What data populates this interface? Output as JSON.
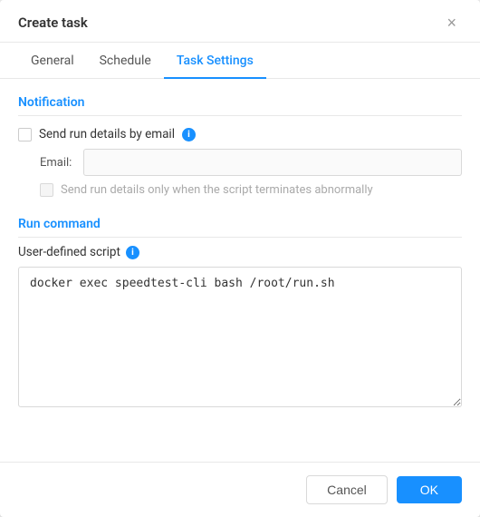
{
  "dialog": {
    "title": "Create task",
    "close_label": "×"
  },
  "tabs": [
    {
      "id": "general",
      "label": "General",
      "active": false
    },
    {
      "id": "schedule",
      "label": "Schedule",
      "active": false
    },
    {
      "id": "task-settings",
      "label": "Task Settings",
      "active": true
    }
  ],
  "notification": {
    "section_title": "Notification",
    "send_email_label": "Send run details by email",
    "email_label": "Email:",
    "email_placeholder": "",
    "abnormal_label": "Send run details only when the script terminates abnormally"
  },
  "run_command": {
    "section_title": "Run command",
    "script_label": "User-defined script",
    "script_value": "docker exec speedtest-cli bash /root/run.sh"
  },
  "footer": {
    "cancel_label": "Cancel",
    "ok_label": "OK"
  },
  "icons": {
    "info": "i",
    "close": "×"
  }
}
